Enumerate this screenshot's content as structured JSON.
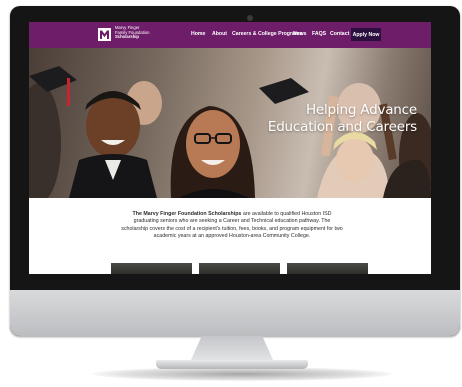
{
  "site": {
    "logo": {
      "line1": "Marvy Finger",
      "line2": "Family Foundation",
      "line3": "Scholarship"
    },
    "nav": {
      "items": [
        {
          "label": "Home"
        },
        {
          "label": "About"
        },
        {
          "label": "Careers & College Programs"
        },
        {
          "label": "News"
        },
        {
          "label": "FAQS"
        },
        {
          "label": "Contact"
        }
      ],
      "cta_label": "Apply Now"
    },
    "hero": {
      "heading_line1": "Helping Advance",
      "heading_line2": "Education and Careers"
    },
    "intro": {
      "bold_text": "The Marvy Finger Foundation Scholarships",
      "rest_text": " are available to qualified Houston ISD graduating seniors who are seeking a Career and Technical education pathway. The scholarship covers the cost of a recipient's tuition, fees, books, and program equipment for two academic years at an approved Houston-area Community College."
    }
  },
  "colors": {
    "nav_background": "#6e1d69",
    "cta_background": "#2b0f3f",
    "logo_text": "#ffffff"
  },
  "icons": {
    "logo": "mf-monogram-icon",
    "camera": "webcam-icon"
  }
}
